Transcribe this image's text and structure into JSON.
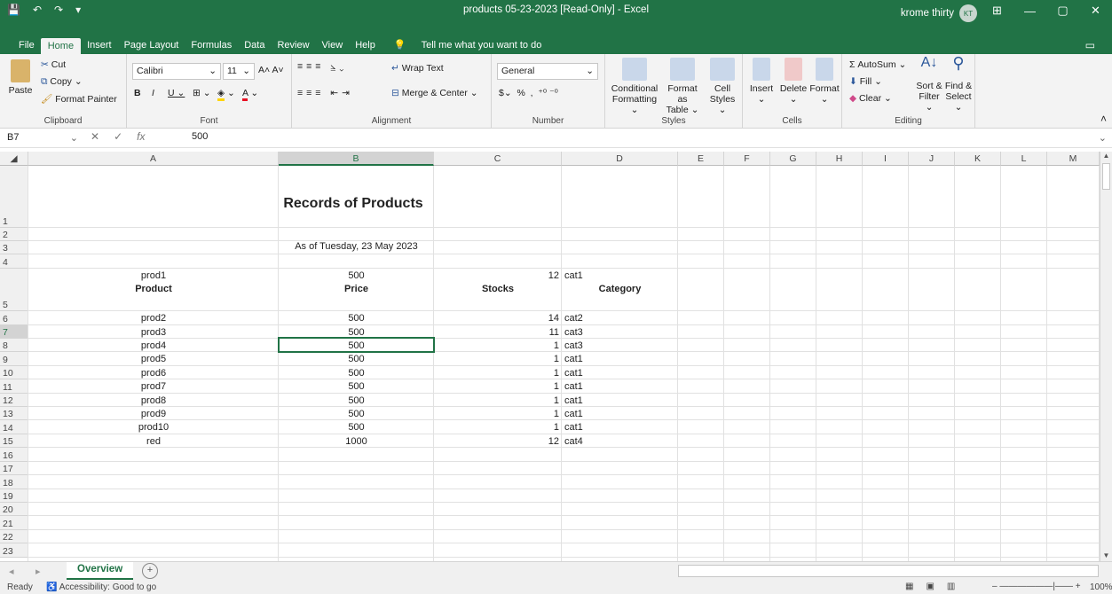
{
  "titlebar": {
    "qat": [
      "💾",
      "↶",
      "↷",
      "▾"
    ],
    "title": "products 05-23-2023  [Read-Only]  -  Excel",
    "user": "krome thirty",
    "initials": "KT",
    "controls": [
      "⊞",
      "—",
      "▢",
      "✕"
    ]
  },
  "menu": {
    "tabs": [
      "File",
      "Home",
      "Insert",
      "Page Layout",
      "Formulas",
      "Data",
      "Review",
      "View",
      "Help"
    ],
    "tell": "Tell me what you want to do"
  },
  "ribbon": {
    "clipboard": {
      "label": "Clipboard",
      "paste": "Paste",
      "cut": "Cut",
      "copy": "Copy",
      "painter": "Format Painter"
    },
    "font": {
      "label": "Font",
      "name": "Calibri",
      "size": "11"
    },
    "alignment": {
      "label": "Alignment",
      "wrap": "Wrap Text",
      "merge": "Merge & Center"
    },
    "number": {
      "label": "Number",
      "format": "General"
    },
    "styles": {
      "label": "Styles",
      "cond": "Conditional",
      "cond2": "Formatting",
      "fmt": "Format as",
      "fmt2": "Table",
      "cell": "Cell",
      "cell2": "Styles"
    },
    "cells": {
      "label": "Cells",
      "insert": "Insert",
      "delete": "Delete",
      "format": "Format"
    },
    "editing": {
      "label": "Editing",
      "autosum": "AutoSum",
      "fill": "Fill",
      "clear": "Clear",
      "sort": "Sort &",
      "sort2": "Filter",
      "find": "Find &",
      "find2": "Select"
    }
  },
  "formula": {
    "namebox": "B7",
    "value": "500"
  },
  "columns": [
    "A",
    "B",
    "C",
    "D",
    "E",
    "F",
    "G",
    "H",
    "I",
    "J",
    "K",
    "L",
    "M"
  ],
  "sheet": {
    "title": "Records of Products",
    "date": "As of Tuesday, 23 May 2023",
    "headers": {
      "product": "Product",
      "price": "Price",
      "stocks": "Stocks",
      "category": "Category"
    },
    "rows": [
      {
        "product": "prod1",
        "price": "500",
        "stocks": "12",
        "category": "cat1"
      },
      {
        "product": "prod2",
        "price": "500",
        "stocks": "14",
        "category": "cat2"
      },
      {
        "product": "prod3",
        "price": "500",
        "stocks": "11",
        "category": "cat3"
      },
      {
        "product": "prod4",
        "price": "500",
        "stocks": "1",
        "category": "cat3"
      },
      {
        "product": "prod5",
        "price": "500",
        "stocks": "1",
        "category": "cat1"
      },
      {
        "product": "prod6",
        "price": "500",
        "stocks": "1",
        "category": "cat1"
      },
      {
        "product": "prod7",
        "price": "500",
        "stocks": "1",
        "category": "cat1"
      },
      {
        "product": "prod8",
        "price": "500",
        "stocks": "1",
        "category": "cat1"
      },
      {
        "product": "prod9",
        "price": "500",
        "stocks": "1",
        "category": "cat1"
      },
      {
        "product": "prod10",
        "price": "500",
        "stocks": "1",
        "category": "cat1"
      },
      {
        "product": "red",
        "price": "1000",
        "stocks": "12",
        "category": "cat4"
      }
    ]
  },
  "tabs": {
    "active": "Overview",
    "add": "+"
  },
  "status": {
    "ready": "Ready",
    "accessibility": "Accessibility: Good to go",
    "zoom": "100%"
  }
}
